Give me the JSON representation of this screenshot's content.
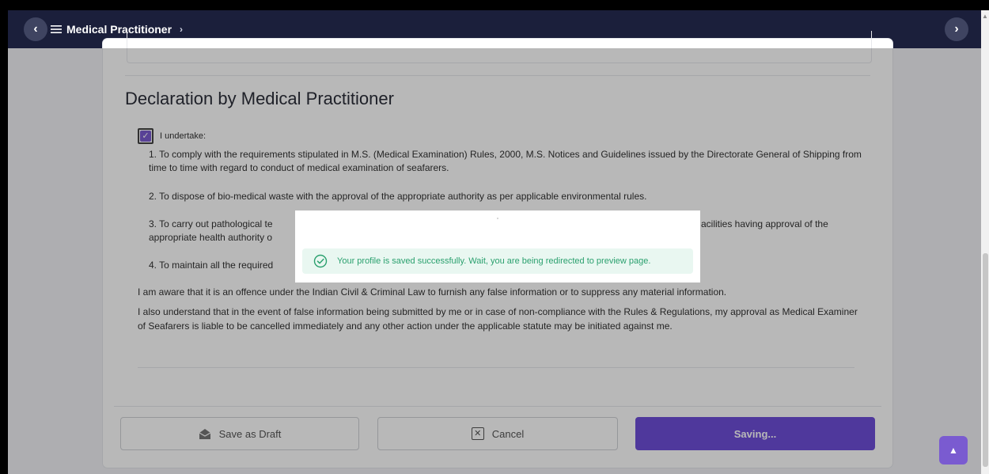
{
  "header": {
    "back_icon": "chevron-left-icon",
    "menu_icon": "menu-icon",
    "breadcrumb_label": "Medical Practitioner",
    "breadcrumb_chevron": "›",
    "forward_icon": "chevron-right-icon"
  },
  "declaration": {
    "title": "Declaration by Medical Practitioner",
    "checkbox_checked": true,
    "checkbox_label": "I undertake:",
    "clauses": [
      "1. To comply with the requirements stipulated in M.S. (Medical Examination) Rules, 2000, M.S. Notices and Guidelines issued by the Directorate General of Shipping from time to time with regard to conduct of medical examination of seafarers.",
      "2. To dispose of bio-medical waste with the approval of the appropriate authority as per applicable environmental rules.",
      "3. To carry out pathological te",
      "acilities having approval of the",
      "appropriate health authority o",
      "4. To maintain all the required"
    ],
    "awareness_text": "I am aware that it is an offence under the Indian Civil & Criminal Law to furnish any false information or to suppress any material information.",
    "understanding_text": "I also understand that in the event of false information being submitted by me or in case of non-compliance with the Rules & Regulations, my approval as Medical Examiner of Seafarers is liable to be cancelled immediately and any other action under the applicable statute may be initiated against me."
  },
  "footer": {
    "save_draft_label": "Save as Draft",
    "cancel_label": "Cancel",
    "saving_label": "Saving..."
  },
  "toast": {
    "message": "Your profile is saved successfully. Wait, you are being redirected to preview page.",
    "icon": "check-circle-icon"
  },
  "colors": {
    "topbar": "#1b1f3b",
    "accent": "#6e4ed8",
    "success": "#2aa06e",
    "success_bg": "#e9f7f1"
  }
}
